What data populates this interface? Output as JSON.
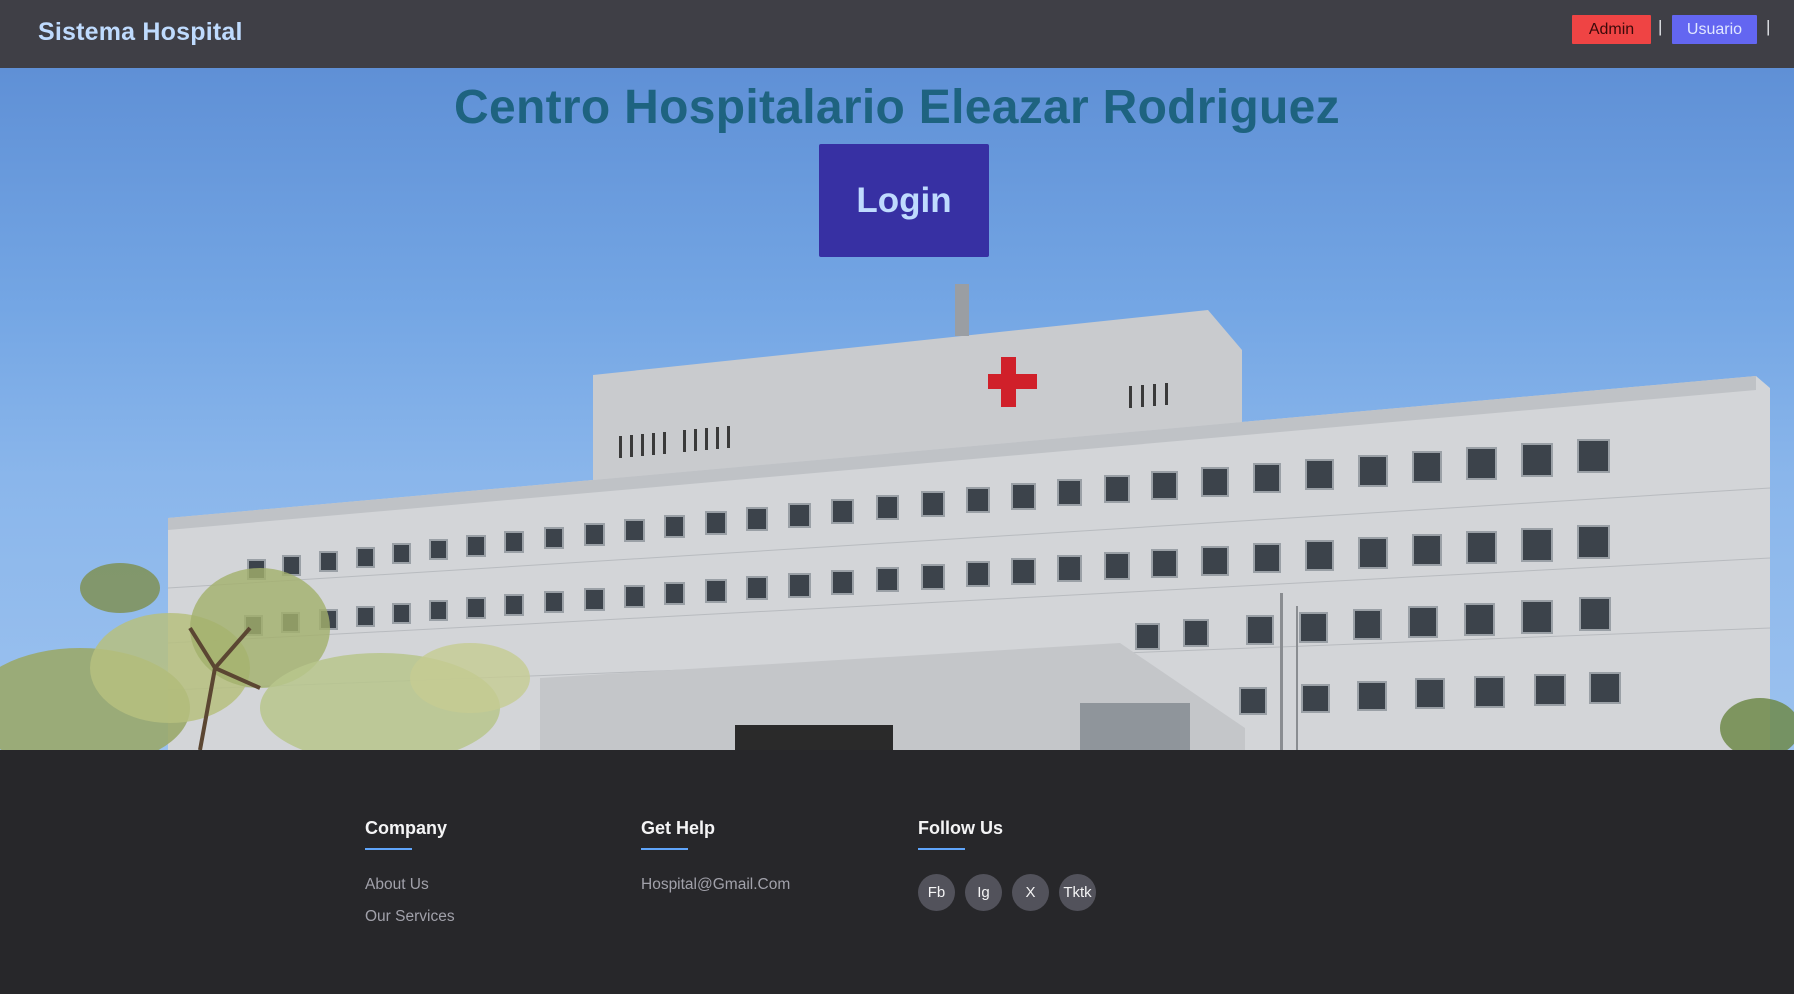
{
  "navbar": {
    "brand": "Sistema Hospital",
    "admin_label": "Admin",
    "usuario_label": "Usuario",
    "separator": "|"
  },
  "hero": {
    "title": "Centro Hospitalario Eleazar Rodriguez",
    "login_label": "Login"
  },
  "footer": {
    "company": {
      "title": "Company",
      "links": [
        "About Us",
        "Our Services"
      ]
    },
    "help": {
      "title": "Get Help",
      "links": [
        "Hospital@Gmail.Com"
      ]
    },
    "follow": {
      "title": "Follow Us",
      "socials": [
        "Fb",
        "Ig",
        "X",
        "Tktk"
      ]
    }
  },
  "colors": {
    "navbar_bg": "#3f3f46",
    "brand": "#bfdbfe",
    "admin_button": "#ef4444",
    "usuario_button": "#6366f1",
    "login_button": "#3730a3",
    "hero_title": "#1e6380",
    "footer_bg": "#27272a",
    "accent_underline": "#60a5fa"
  }
}
